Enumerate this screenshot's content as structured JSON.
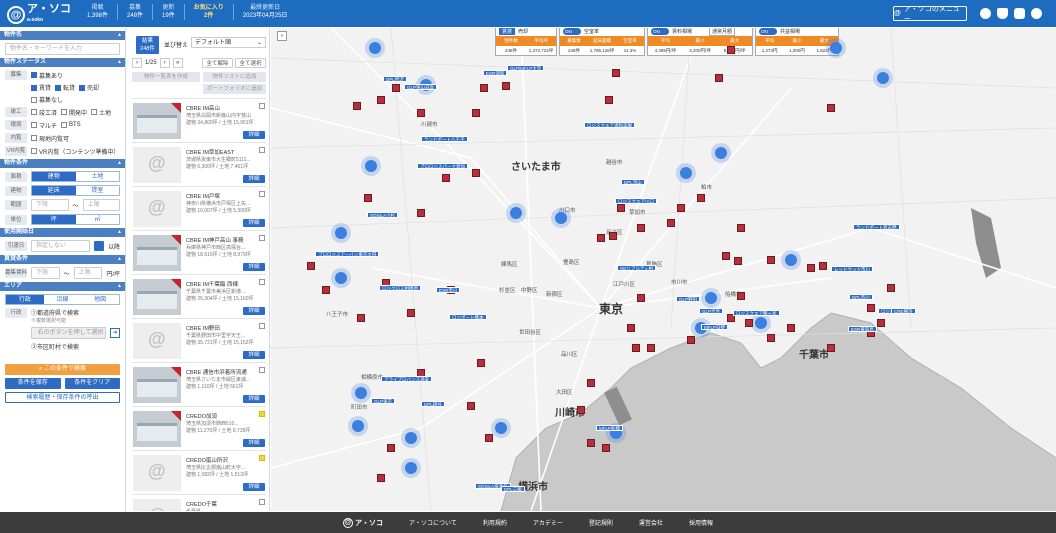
{
  "header": {
    "logo_mark": "@",
    "logo_text": "ア・ソコ",
    "logo_sub": "a-soko",
    "stats": [
      {
        "label": "掲載",
        "value": "1,398件"
      },
      {
        "label": "募集",
        "value": "248件"
      },
      {
        "label": "更新",
        "value": "19件"
      },
      {
        "label": "お気に入り",
        "value": "2件",
        "highlight": true
      },
      {
        "label": "最終更新日",
        "value": "2023年04月25日"
      }
    ],
    "menu_label": "ア・ソコのメニュー"
  },
  "sidebar": {
    "name_section": "物件名",
    "name_placeholder": "物件名・キーワードを入力",
    "status_section": "物件ステータス",
    "recruit_tag": "募集",
    "recruit_all": "募集あり",
    "recruit_opts": [
      "賃貸",
      "転貸",
      "売却"
    ],
    "recruit_none": "募集なし",
    "complete_tag": "竣工",
    "complete_opts": [
      "竣工済",
      "開発中",
      "土地"
    ],
    "type_tag": "環境",
    "type_opts": [
      "マルチ",
      "BTS"
    ],
    "view_tag": "内覧",
    "view_opt": "現地内覧可",
    "vr_tag": "VR内覧",
    "vr_opt": "VR内覧（コンテンツ準備中）",
    "cond_section": "物件条件",
    "area_tag": "面積",
    "area_opts": [
      "建物",
      "土地"
    ],
    "floor_tag": "建物",
    "floor_opts": [
      "延床",
      "貸室"
    ],
    "range_tag": "範囲",
    "range_from": "下限",
    "range_to": "上限",
    "unit_tag": "単位",
    "unit_opts": [
      "坪",
      "㎡"
    ],
    "date_section": "使用開始日",
    "date_tag": "引渡日",
    "date_placeholder": "指定しない",
    "date_suffix": "以降",
    "cost_section": "賃貸条件",
    "cost_tag": "募集賃料",
    "cost_unit": "円/坪",
    "area_section": "エリア",
    "area_tabs": [
      "行政",
      "沿線",
      "地図"
    ],
    "pref_tag": "行政",
    "pref_label": "①都道府県で検索",
    "pref_sub": "※複数選択可能",
    "pref_btn": "右のボタンを押して選択",
    "city_label": "②市区町村で検索",
    "search_btn": "この条件で検索",
    "save_btn": "条件を保存",
    "clear_btn": "条件をクリア",
    "history_btn": "検索履歴・保存条件の呼出"
  },
  "list": {
    "count_label": "結果",
    "count_value": "248件",
    "sort_label": "並び替え",
    "sort_value": "デフォルト順",
    "page": "1/25",
    "btn_clear": "全て解除",
    "btn_select": "全て選択",
    "btn_compare": "物件一覧表を作成",
    "btn_map": "物件リストに追加",
    "btn_portfolio": "ポートフォリオに追加",
    "detail_label": "詳細",
    "items": [
      {
        "name": "CBRE IM高山",
        "addr": "埼玉県白岡市新篠山内字荒山",
        "area": "建物 34,800坪 / 土地 15,951坪",
        "photo": true,
        "fav": false
      },
      {
        "name": "CBRE IM草加EAST",
        "addr": "茨城県坂東市大生郷町5111...",
        "area": "建物 6,300坪 / 土地 7,461坪",
        "photo": false,
        "fav": false
      },
      {
        "name": "CBRE IM戸塚",
        "addr": "神奈川県横浜市戸塚区上矢...",
        "area": "建物 10,007坪 / 土地 5,300坪",
        "photo": false,
        "fav": false
      },
      {
        "name": "CBRE IM神戸高山 事務",
        "addr": "兵庫県神戸市西区高塚台...",
        "area": "建物 18,616坪 / 土地 8,979坪",
        "photo": true,
        "fav": false
      },
      {
        "name": "CBRE IM千葉臨 西棟",
        "addr": "千葉県千葉市美浜区新港...",
        "area": "建物 25,304坪 / 土地 15,160坪",
        "photo": true,
        "fav": false
      },
      {
        "name": "CBRE IM野田",
        "addr": "千葉県野田市中里字天王...",
        "area": "建物 35,721坪 / 土地 15,152坪",
        "photo": false,
        "fav": false
      },
      {
        "name": "CBRE 通信市浜着所流通",
        "addr": "埼玉県さいたま市緑区東浦...",
        "area": "建物 1,110坪 / 土地 561坪",
        "photo": true,
        "fav": false
      },
      {
        "name": "CREDO加須",
        "addr": "埼玉県加須市騎西510...",
        "area": "建物 11,270坪 / 土地 8,739坪",
        "photo": true,
        "fav": true
      },
      {
        "name": "CREDO嵐山所沢",
        "addr": "埼玉県比企郡嵐山町大字...",
        "area": "建物 1,082坪 / 土地 1,513坪",
        "photo": false,
        "fav": true
      },
      {
        "name": "CREDO千葉",
        "addr": "千葉県...",
        "area": "建物 ...",
        "photo": false,
        "fav": false
      }
    ]
  },
  "map_panels": {
    "recruit": {
      "title": "賃貸 募集",
      "tabs": [
        "賃貸",
        "売却"
      ],
      "cols": [
        "物件数",
        "平均坪",
        "延床"
      ],
      "vals": [
        "248件",
        "1,372,724坪",
        ""
      ]
    },
    "vacancy": {
      "toggle": "ON",
      "title": "空室率",
      "cols": [
        "募集数",
        "延床面積",
        "空室率"
      ],
      "vals": [
        "248件",
        "1,785,126坪",
        "11.3%"
      ]
    },
    "rent": {
      "toggle": "ON",
      "title": "賃料相場",
      "select": "通常月額",
      "cols": [
        "平均",
        "最小",
        "最大"
      ],
      "vals": [
        "4,395円/坪",
        "3,200円/坪",
        "8,600円/坪"
      ]
    },
    "fee": {
      "toggle": "ON",
      "title": "共益相場",
      "cols": [
        "平均",
        "最小",
        "最大"
      ],
      "vals": [
        "1,273円",
        "1,000円",
        "1,823円"
      ]
    }
  },
  "map": {
    "cities": [
      "さいたま市",
      "東京",
      "川崎市",
      "横浜市",
      "千葉市"
    ],
    "wards": [
      "川越市",
      "八王子市",
      "川口市",
      "練馬区",
      "杉並区",
      "豊島区",
      "中野区",
      "新宿区",
      "世田谷区",
      "品川区",
      "大田区",
      "足立区",
      "葛飾区",
      "江戸川区",
      "船橋市",
      "柏市",
      "越谷市",
      "草加市",
      "町田市",
      "相模原市",
      "市川市"
    ],
    "labels": [
      "DPL所沢",
      "GLP狭山日高",
      "ESR浦和",
      "GLP/MFLP大宮",
      "ロジスクエア浦和美園",
      "ランドポート八王子",
      "プロロジスパーク草加",
      "DPL流山",
      "ロジスクエア川口",
      "SOSiLA小杉",
      "プロロジスアーバン東京大田",
      "ロジクロス相模原",
      "ESR市川",
      "ロジポート橋本",
      "MFLP船橋",
      "アライプロバンス浦安",
      "GLP東京",
      "ロジスクエア鶴ヶ島",
      "DPL越谷",
      "GLP吉見",
      "MFLP日野",
      "SGリアルティ柏",
      "GLP野田",
      "レッドウッド市川",
      "DPL市川",
      "ロジスタ厚木",
      "ESR東扇島",
      "CRE横浜",
      "SOSiLA海老名",
      "DPL三郷",
      "ランドポート習志野"
    ]
  },
  "footer": {
    "logo": "ア・ソコ",
    "links": [
      "ア・ソコについて",
      "利用規約",
      "アカデミー",
      "登記規則",
      "運営会社",
      "採用情報"
    ]
  },
  "colors": {
    "brand": "#1e6cc0",
    "accent": "#f08a24",
    "marker": "#b5303a",
    "cluster": "#3b7fe0"
  }
}
